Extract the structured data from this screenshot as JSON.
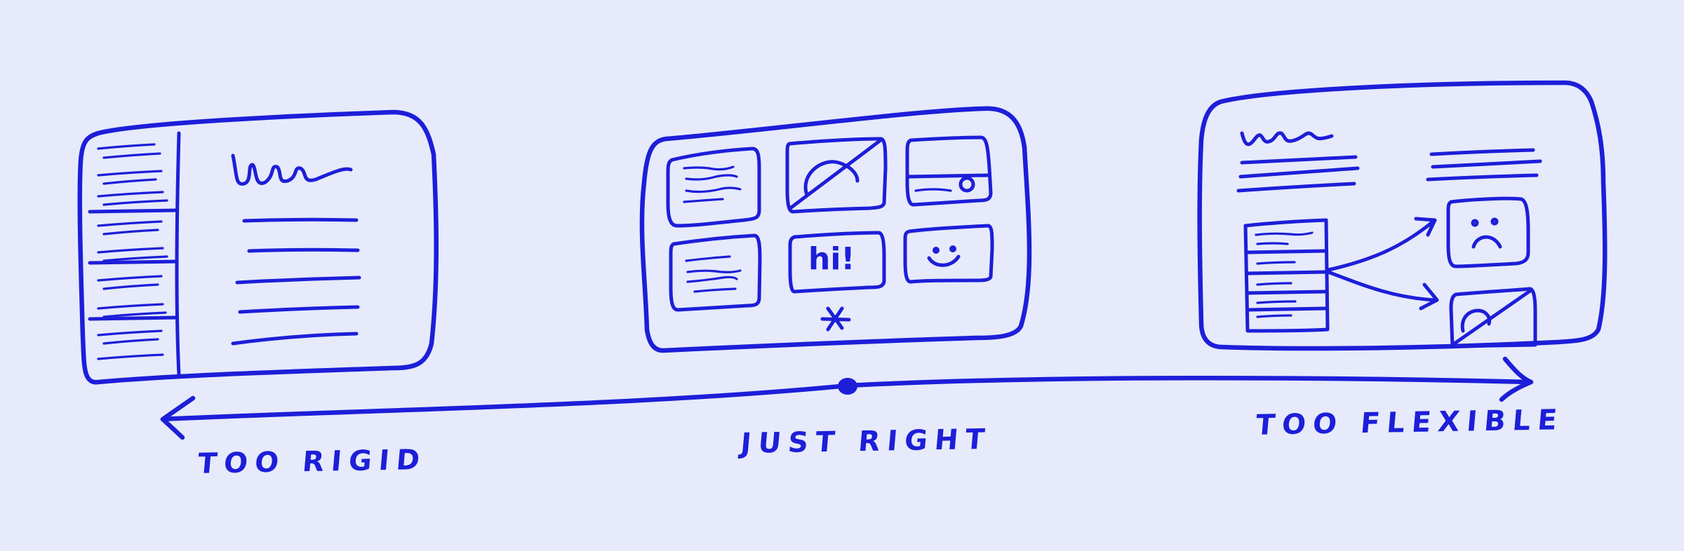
{
  "labels": {
    "left": "TOO RIGID",
    "center": "JUST RIGHT",
    "right": "TOO FLEXIBLE"
  },
  "center_card_text": "hi!",
  "colors": {
    "background": "#e6eafb",
    "ink": "#1d1ed8"
  },
  "icons": [
    "star-icon",
    "smiley-icon",
    "sad-face-icon",
    "image-icon",
    "arrow-icon"
  ]
}
